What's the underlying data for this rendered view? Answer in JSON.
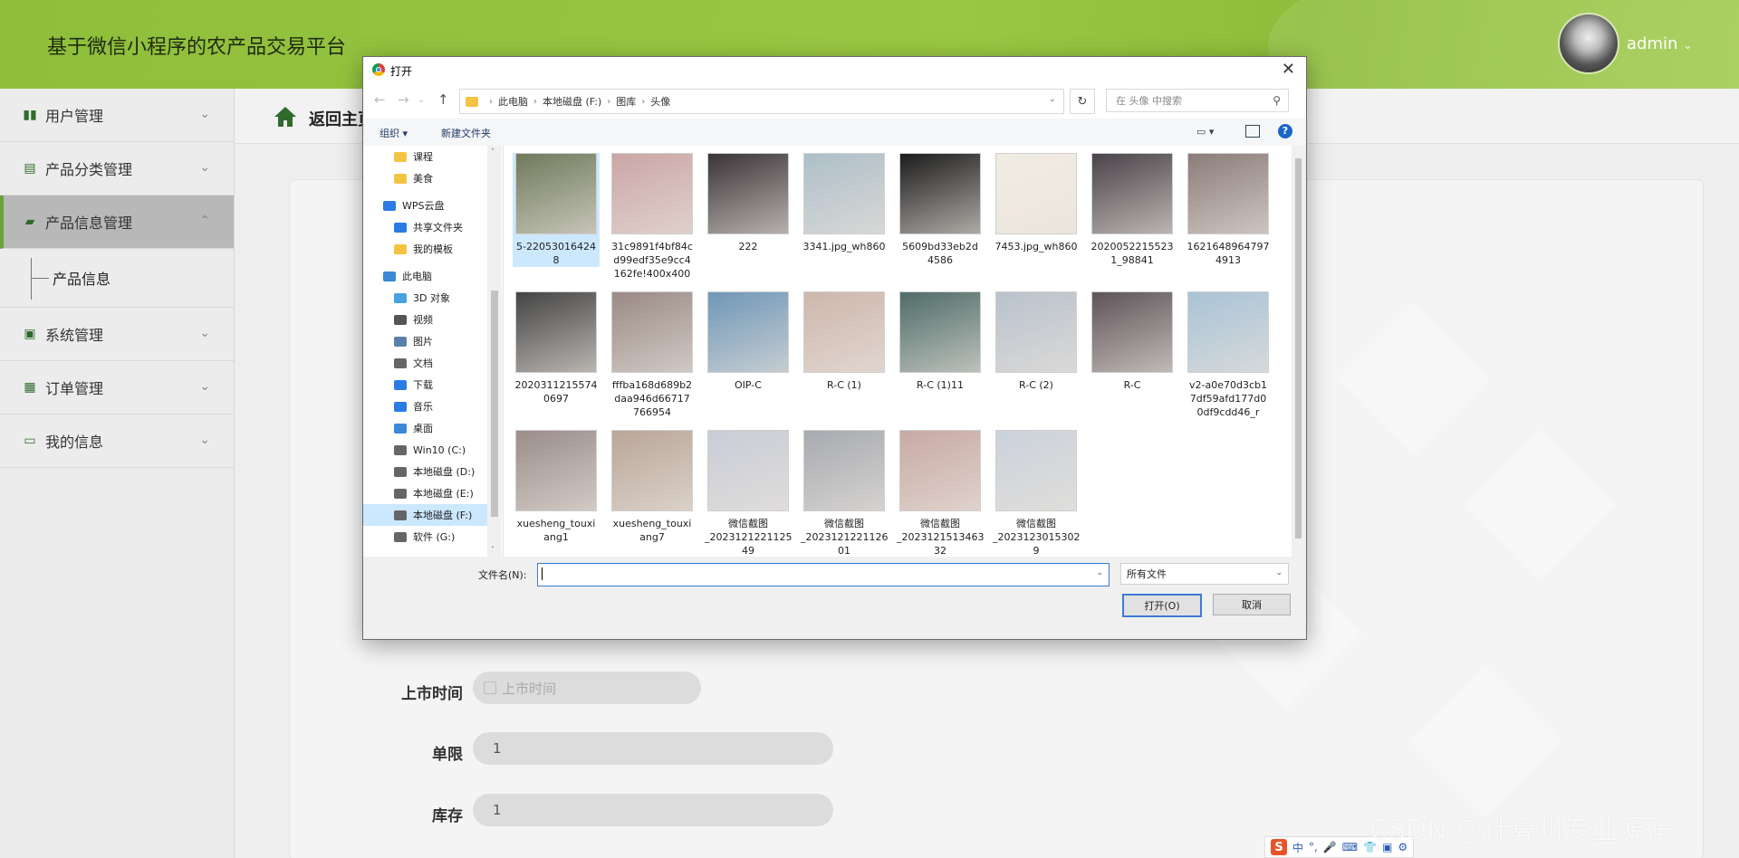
{
  "header": {
    "title": "基于微信小程序的农产品交易平台",
    "user": "admin"
  },
  "sidebar": {
    "items": [
      {
        "label": "用户管理",
        "icon": "bar-chart-icon"
      },
      {
        "label": "产品分类管理",
        "icon": "chat-icon"
      },
      {
        "label": "产品信息管理",
        "icon": "briefcase-icon",
        "active": true
      },
      {
        "label": "系统管理",
        "icon": "wallet-icon"
      },
      {
        "label": "订单管理",
        "icon": "grid-icon"
      },
      {
        "label": "我的信息",
        "icon": "card-icon"
      }
    ],
    "sub_item": "产品信息"
  },
  "breadcrumb": {
    "text": "返回主页"
  },
  "form": {
    "release_time_label": "上市时间",
    "release_time_placeholder": "上市时间",
    "limit_label": "单限",
    "limit_value": "1",
    "stock_label": "库存",
    "stock_value": "1"
  },
  "dialog": {
    "title": "打开",
    "path": [
      "此电脑",
      "本地磁盘 (F:)",
      "图库",
      "头像"
    ],
    "search_placeholder": "在 头像 中搜索",
    "organize": "组织 ▾",
    "new_folder": "新建文件夹",
    "nav_items": [
      {
        "label": "课程",
        "icon": "folder-icon"
      },
      {
        "label": "美食",
        "icon": "folder-icon"
      },
      {
        "label": "WPS云盘",
        "icon": "cloud-icon"
      },
      {
        "label": "共享文件夹",
        "icon": "share-icon"
      },
      {
        "label": "我的模板",
        "icon": "folder-icon"
      },
      {
        "label": "此电脑",
        "icon": "computer-icon"
      },
      {
        "label": "3D 对象",
        "icon": "cube-icon"
      },
      {
        "label": "视频",
        "icon": "video-icon"
      },
      {
        "label": "图片",
        "icon": "picture-icon"
      },
      {
        "label": "文档",
        "icon": "document-icon"
      },
      {
        "label": "下载",
        "icon": "download-icon"
      },
      {
        "label": "音乐",
        "icon": "music-icon"
      },
      {
        "label": "桌面",
        "icon": "desktop-icon"
      },
      {
        "label": "Win10 (C:)",
        "icon": "drive-icon"
      },
      {
        "label": "本地磁盘 (D:)",
        "icon": "drive-icon"
      },
      {
        "label": "本地磁盘 (E:)",
        "icon": "drive-icon"
      },
      {
        "label": "本地磁盘 (F:)",
        "icon": "drive-icon",
        "selected": true
      },
      {
        "label": "软件 (G:)",
        "icon": "drive-icon"
      }
    ],
    "files": [
      {
        "name": "5-22053016424\n8",
        "color": "#6f7a5c",
        "selected": true
      },
      {
        "name": "31c9891f4bf84c\nd99edf35e9cc4\n162fe!400x400",
        "color": "#caa6a6"
      },
      {
        "name": "222",
        "color": "#3b3438"
      },
      {
        "name": "3341.jpg_wh860",
        "color": "#aebfc8"
      },
      {
        "name": "5609bd33eb2d\n4586",
        "color": "#1c1c1c"
      },
      {
        "name": "7453.jpg_wh860",
        "color": "#f1ece3"
      },
      {
        "name": "2020052215523\n1_98841",
        "color": "#4a4349"
      },
      {
        "name": "1621648964797\n4913",
        "color": "#8b7c7a"
      },
      {
        "name": "2020311215574\n0697",
        "color": "#444"
      },
      {
        "name": "fffba168d689b2\ndaa946d66717\n766954",
        "color": "#9a8a86"
      },
      {
        "name": "OIP-C",
        "color": "#6f97b7"
      },
      {
        "name": "R-C (1)",
        "color": "#cdb7ad"
      },
      {
        "name": "R-C (1)11",
        "color": "#4f6c68"
      },
      {
        "name": "R-C (2)",
        "color": "#b9c2cc"
      },
      {
        "name": "R-C",
        "color": "#5d5458"
      },
      {
        "name": "v2-a0e70d3cb1\n7df59afd177d0\n0df9cdd46_r",
        "color": "#a9c3d6"
      },
      {
        "name": "xuesheng_touxi\nang1",
        "color": "#9a8d8a"
      },
      {
        "name": "xuesheng_touxi\nang7",
        "color": "#b9a698"
      },
      {
        "name": "微信截图\n_2023121221125\n49",
        "color": "#c9cdd6"
      },
      {
        "name": "微信截图\n_2023121221126\n01",
        "color": "#a7aab0"
      },
      {
        "name": "微信截图\n_2023121513463\n32",
        "color": "#c8a9a4"
      },
      {
        "name": "微信截图\n_2023123015302\n9",
        "color": "#cbd2da"
      }
    ],
    "filename_label": "文件名(N):",
    "filename_value": "",
    "filetype": "所有文件",
    "open_button": "打开(O)",
    "cancel_button": "取消"
  },
  "ime": {
    "items": [
      "中",
      "°,",
      "🎤",
      "⌨",
      "👕",
      "▣",
      "⚙"
    ]
  },
  "watermark": "CSDN @计算机专业源码"
}
